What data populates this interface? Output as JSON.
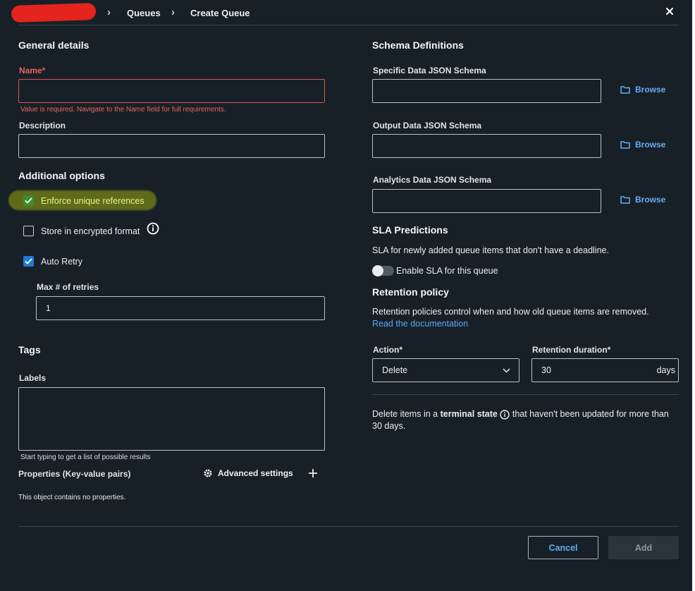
{
  "breadcrumb": {
    "items": [
      "Queues",
      "Create Queue"
    ]
  },
  "general": {
    "heading": "General details",
    "name_label": "Name*",
    "name_value": "",
    "name_error": "Value is required. Navigate to the Name field for full requirements.",
    "description_label": "Description",
    "description_value": ""
  },
  "additional": {
    "heading": "Additional options",
    "enforce_unique": {
      "label": "Enforce unique references",
      "checked": true
    },
    "encrypted": {
      "label": "Store in encrypted format",
      "checked": false
    },
    "auto_retry": {
      "label": "Auto Retry",
      "checked": true
    },
    "max_retries_label": "Max # of retries",
    "max_retries_value": "1"
  },
  "tags": {
    "heading": "Tags",
    "labels_label": "Labels",
    "labels_hint": "Start typing to get a list of possible results",
    "properties_label": "Properties (Key-value pairs)",
    "advanced_settings": "Advanced settings",
    "no_properties": "This object contains no properties."
  },
  "schema": {
    "heading": "Schema Definitions",
    "browse_label": "Browse",
    "fields": [
      {
        "label": "Specific Data JSON Schema",
        "value": ""
      },
      {
        "label": "Output Data JSON Schema",
        "value": ""
      },
      {
        "label": "Analytics Data JSON Schema",
        "value": ""
      }
    ]
  },
  "sla": {
    "heading": "SLA Predictions",
    "description": "SLA for newly added queue items that don't have a deadline.",
    "toggle_label": "Enable SLA for this queue",
    "enabled": false
  },
  "retention": {
    "heading": "Retention policy",
    "description": "Retention policies control when and how old queue items are removed.",
    "doc_link": "Read the documentation",
    "action_label": "Action*",
    "action_value": "Delete",
    "duration_label": "Retention duration*",
    "duration_value": "30",
    "duration_unit": "days",
    "summary_prefix": "Delete items in a",
    "summary_bold": "terminal state",
    "summary_line1_suffix": "that haven't been updated for more than",
    "summary_line2": "30 days."
  },
  "footer": {
    "cancel": "Cancel",
    "add": "Add"
  },
  "colors": {
    "background": "#182027",
    "accent": "#1f7bd8",
    "link": "#5aa9f2",
    "error": "#e5645f"
  }
}
